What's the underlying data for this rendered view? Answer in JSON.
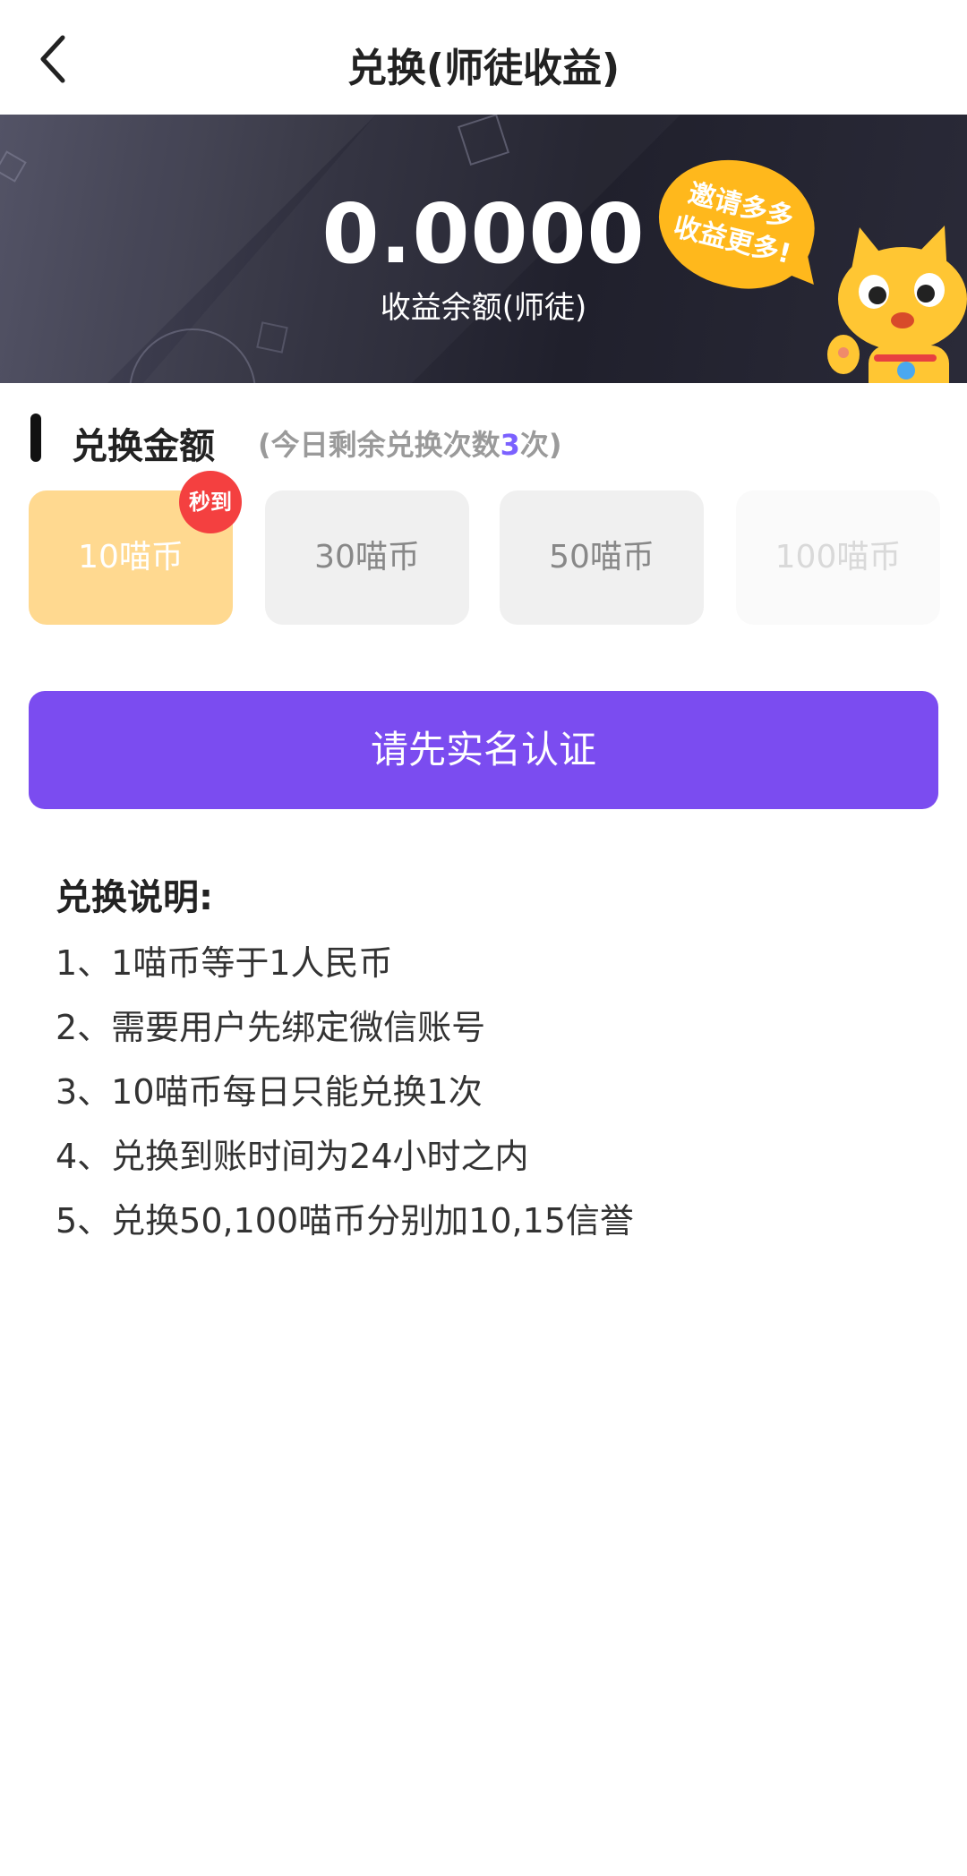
{
  "navbar": {
    "title": "兑换(师徒收益)",
    "back_icon": "chevron-left-icon"
  },
  "banner": {
    "balance": "0.0000",
    "balance_label": "收益余额(师徒)",
    "bubble_line1": "邀请多多",
    "bubble_line2": "收益更多!",
    "mascot": "cat-mascot-icon",
    "bubble_color": "#ffb81c"
  },
  "section": {
    "title": "兑换金额",
    "sub_prefix": "(今日剩余兑换次数",
    "sub_count": "3",
    "sub_suffix": "次)"
  },
  "options": [
    {
      "label": "10喵币",
      "state": "selected",
      "badge": "秒到"
    },
    {
      "label": "30喵币",
      "state": "normal"
    },
    {
      "label": "50喵币",
      "state": "normal"
    },
    {
      "label": "100喵币",
      "state": "disabled"
    }
  ],
  "primary_button": {
    "label": "请先实名认证",
    "color": "#7b4cf0"
  },
  "notes": {
    "title": "兑换说明:",
    "items": [
      "1、1喵币等于1人民币",
      "2、需要用户先绑定微信账号",
      "3、10喵币每日只能兑换1次",
      "4、兑换到账时间为24小时之内",
      "5、兑换50,100喵币分别加10,15信誉"
    ]
  },
  "colors": {
    "accent": "#7b4cf0",
    "selected_option": "#ffd990",
    "badge": "#f44040",
    "count_highlight": "#7b61ff"
  }
}
